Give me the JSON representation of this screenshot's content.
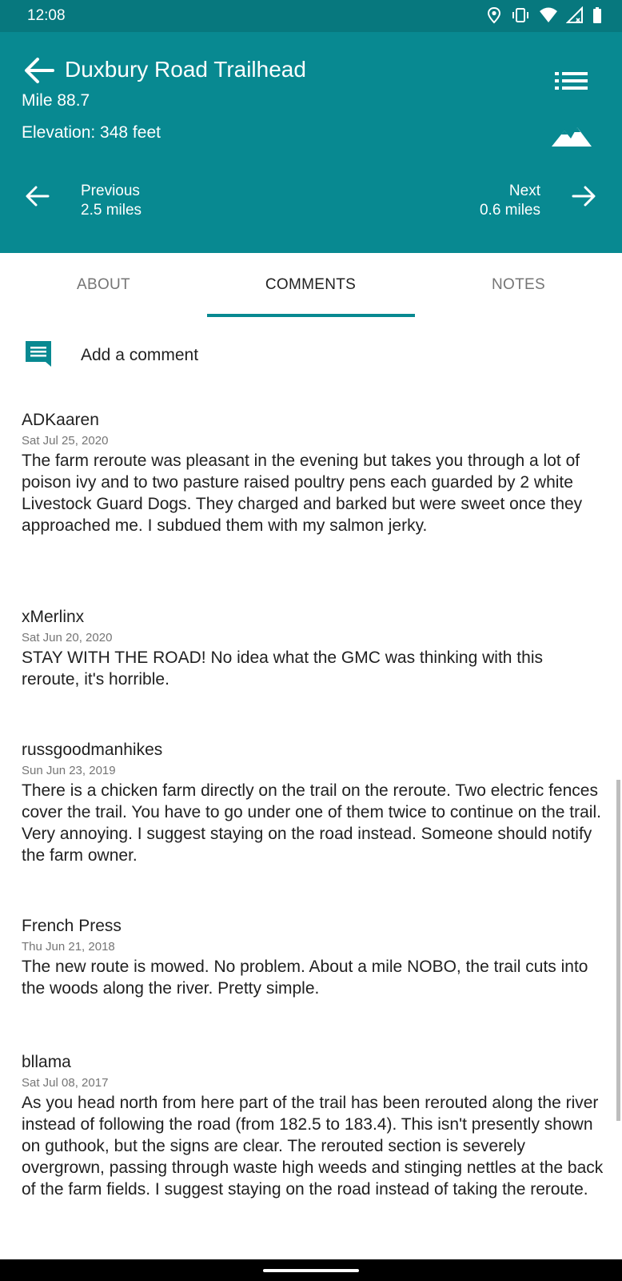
{
  "status_bar": {
    "time": "12:08",
    "icons": [
      "location-icon",
      "vibrate-icon",
      "wifi-icon",
      "signal-icon",
      "battery-icon"
    ]
  },
  "header": {
    "title": "Duxbury Road Trailhead",
    "mile": "Mile 88.7",
    "elevation": "Elevation: 348 feet",
    "previous_label": "Previous",
    "previous_distance": "2.5 miles",
    "next_label": "Next",
    "next_distance": "0.6 miles",
    "background_color": "#088991"
  },
  "tabs": [
    {
      "label": "ABOUT",
      "active": false
    },
    {
      "label": "COMMENTS",
      "active": true
    },
    {
      "label": "NOTES",
      "active": false
    }
  ],
  "add_comment": {
    "label": "Add a comment"
  },
  "comments": [
    {
      "user": "ADKaaren",
      "date": "Sat Jul 25, 2020",
      "text": "The farm reroute was pleasant in the evening but takes you through a lot of poison ivy and to two pasture raised poultry pens each guarded by 2 white Livestock Guard Dogs. They charged and barked but were sweet once they approached me. I subdued them with my salmon jerky."
    },
    {
      "user": "xMerlinx",
      "date": "Sat Jun 20, 2020",
      "text": "STAY WITH THE ROAD! No idea what the GMC was thinking with this reroute, it's horrible."
    },
    {
      "user": "russgoodmanhikes",
      "date": "Sun Jun 23, 2019",
      "text": "There is a chicken farm directly on the trail on the reroute. Two electric fences cover the trail. You have to go under one of them twice to continue on the trail. Very annoying. I suggest staying on the road instead. Someone should notify the farm owner."
    },
    {
      "user": "French Press",
      "date": "Thu Jun 21, 2018",
      "text": "The new route is mowed.  No problem.  About a mile NOBO, the trail cuts into the woods along the river.  Pretty simple."
    },
    {
      "user": "bllama",
      "date": "Sat Jul 08, 2017",
      "text": "As you head north from here part of the trail has been rerouted along the river instead of following the road (from 182.5 to 183.4).  This isn't presently shown on guthook, but the signs are clear.  The rerouted section is severely overgrown, passing through waste high weeds and stinging nettles at the back of the farm fields.  I suggest staying on the road instead of taking the reroute."
    }
  ]
}
